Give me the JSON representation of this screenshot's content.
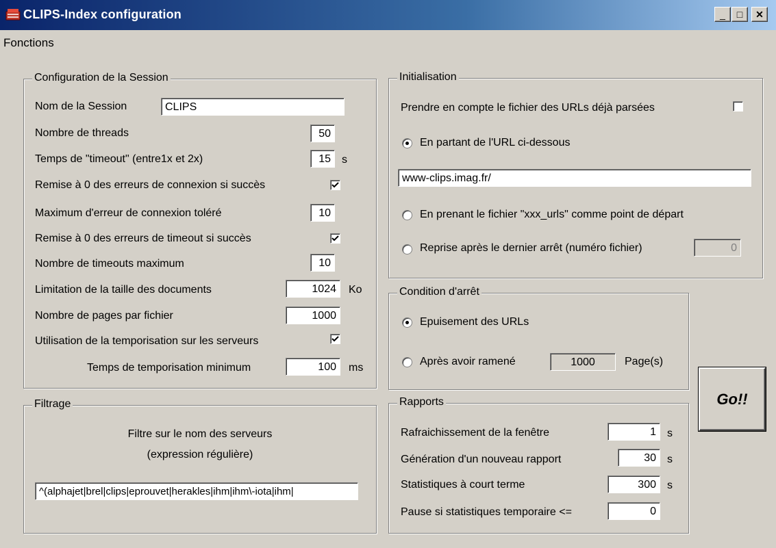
{
  "window": {
    "title": "CLIPS-Index configuration",
    "title_icon": "app-icon",
    "controls": {
      "minimize": "_",
      "maximize": "□",
      "close": "✕"
    }
  },
  "menu": {
    "items": [
      "Fonctions"
    ]
  },
  "session": {
    "legend": "Configuration de la Session",
    "name_label": "Nom de la Session",
    "name_value": "CLIPS",
    "threads_label": "Nombre de threads",
    "threads_value": "50",
    "timeout_label": "Temps de \"timeout\" (entre1x et 2x)",
    "timeout_value": "15",
    "timeout_unit": "s",
    "reset_conn_label": "Remise à 0 des erreurs de connexion si succès",
    "reset_conn_checked": true,
    "max_conn_err_label": "Maximum d'erreur de connexion toléré",
    "max_conn_err_value": "10",
    "reset_timeout_label": "Remise à 0 des erreurs de timeout si succès",
    "reset_timeout_checked": true,
    "max_timeouts_label": "Nombre de timeouts maximum",
    "max_timeouts_value": "10",
    "doc_size_label": "Limitation de la taille des documents",
    "doc_size_value": "1024",
    "doc_size_unit": "Ko",
    "pages_label": "Nombre de pages par fichier",
    "pages_value": "1000",
    "temporisation_label": "Utilisation de la temporisation sur les serveurs",
    "temporisation_checked": true,
    "temp_min_label": "Temps de temporisation minimum",
    "temp_min_value": "100",
    "temp_min_unit": "ms"
  },
  "filtrage": {
    "legend": "Filtrage",
    "line1": "Filtre sur le nom des serveurs",
    "line2": "(expression régulière)",
    "regex_value": "^(alphajet|brel|clips|eprouvet|herakles|ihm|ihm\\-iota|ihm|"
  },
  "init": {
    "legend": "Initialisation",
    "prendre_label": "Prendre en compte le fichier des URLs déjà parsées",
    "prendre_checked": false,
    "radio1_label": "En partant de l'URL ci-dessous",
    "url_value": "www-clips.imag.fr/",
    "radio2_label": "En prenant le fichier \"xxx_urls\" comme point de départ",
    "radio3_label": "Reprise après le dernier arrêt (numéro fichier)",
    "reprise_value": "0",
    "selected": 1
  },
  "arret": {
    "legend": "Condition d'arrêt",
    "radio1_label": "Epuisement des URLs",
    "radio2_label": "Après avoir ramené",
    "pages_value": "1000",
    "pages_unit": "Page(s)",
    "selected": 1
  },
  "rapports": {
    "legend": "Rapports",
    "refresh_label": "Rafraichissement de la fenêtre",
    "refresh_value": "1",
    "refresh_unit": "s",
    "newreport_label": "Génération d'un nouveau rapport",
    "newreport_value": "30",
    "newreport_unit": "s",
    "stats_label": "Statistiques à court terme",
    "stats_value": "300",
    "stats_unit": "s",
    "pause_label": "Pause si statistiques temporaire <=",
    "pause_value": "0"
  },
  "go_button": {
    "label": "Go!!"
  }
}
